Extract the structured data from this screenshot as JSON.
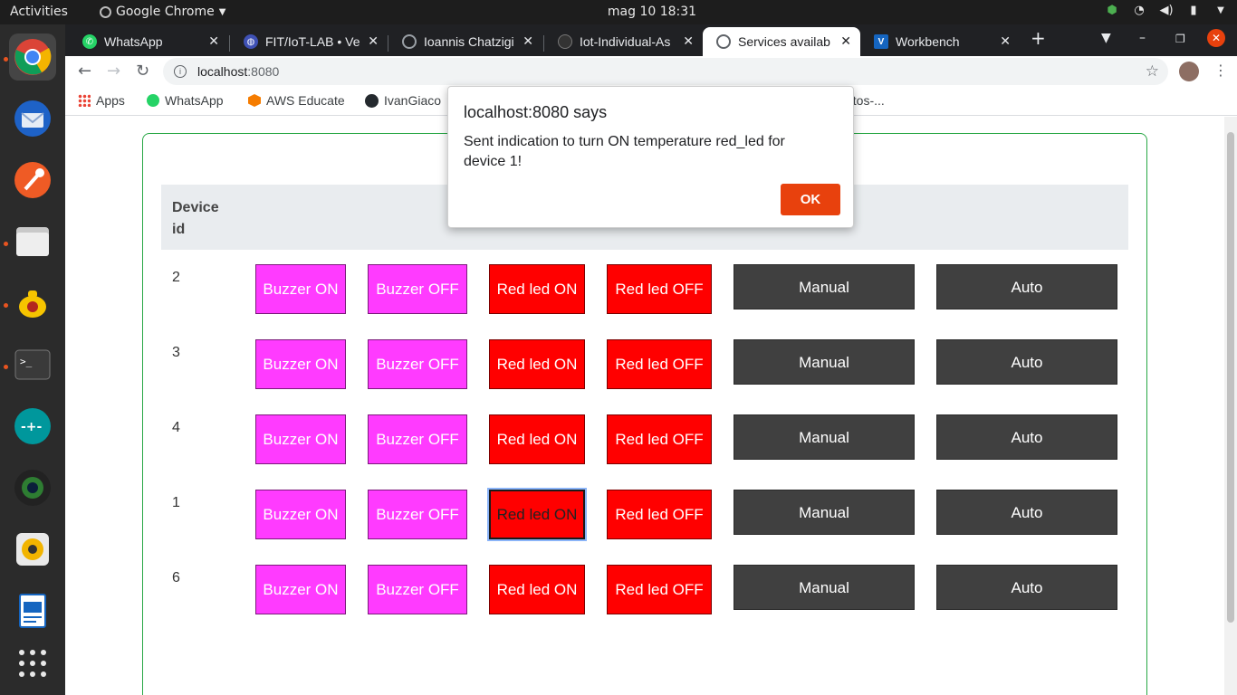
{
  "os": {
    "activities": "Activities",
    "app_name": "Google Chrome",
    "clock": "mag 10  18:31"
  },
  "tabs": [
    {
      "title": "WhatsApp",
      "active": false
    },
    {
      "title": "FIT/IoT-LAB • Ve",
      "active": false
    },
    {
      "title": "Ioannis Chatzigi",
      "active": false
    },
    {
      "title": "Iot-Individual-As",
      "active": false
    },
    {
      "title": "Services availab",
      "active": true
    },
    {
      "title": "Workbench",
      "active": false
    }
  ],
  "omnibox": {
    "host": "localhost",
    "port": ":8080"
  },
  "bookmarks": {
    "apps": "Apps",
    "whatsapp": "WhatsApp",
    "aws": "AWS Educate",
    "github": "IvanGiaco",
    "truncated": "otos-..."
  },
  "table": {
    "header": "Device id",
    "rows": [
      {
        "id": "2"
      },
      {
        "id": "3"
      },
      {
        "id": "4"
      },
      {
        "id": "1"
      },
      {
        "id": "6"
      }
    ],
    "buttons": {
      "buzzer_on": "Buzzer ON",
      "buzzer_off": "Buzzer OFF",
      "red_on": "Red led ON",
      "red_off": "Red led OFF",
      "manual": "Manual",
      "auto": "Auto"
    }
  },
  "dialog": {
    "title": "localhost:8080 says",
    "message": "Sent indication to turn ON temperature red_led for device 1!",
    "ok": "OK"
  },
  "colors": {
    "buzzer": "#ff3bff",
    "red_led": "#ff0000",
    "mode": "#404040",
    "ok_button": "#e8410d",
    "card_border": "#28a745"
  }
}
